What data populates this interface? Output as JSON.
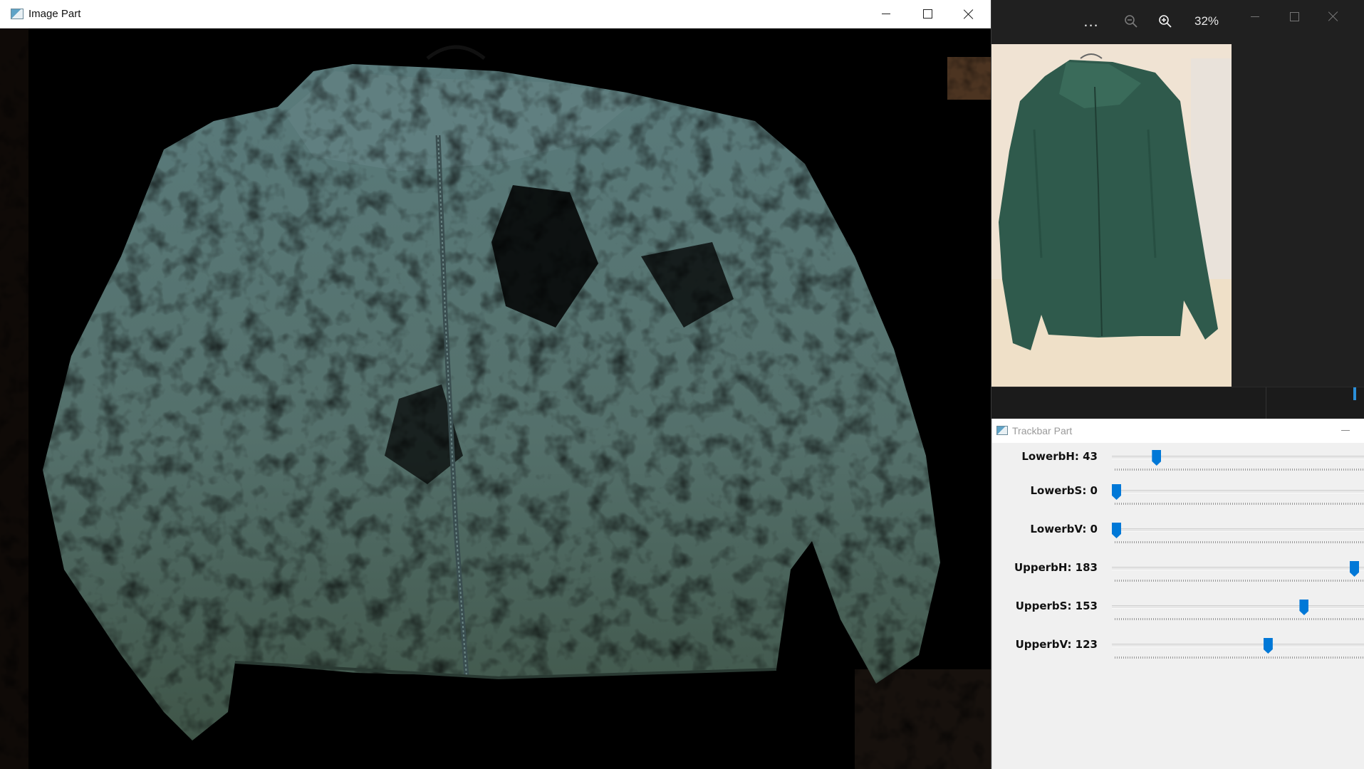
{
  "image_window": {
    "title": "Image Part",
    "controls": [
      "minimize",
      "maximize",
      "close"
    ]
  },
  "photo_viewer": {
    "more_label": "...",
    "zoom_level": "32%",
    "icons": [
      "more-icon",
      "zoom-out-icon",
      "zoom-in-icon"
    ]
  },
  "trackbar_window": {
    "title": "Trackbar Part",
    "trackbars": [
      {
        "label": "LowerbH: 43",
        "value": 43,
        "max": 255
      },
      {
        "label": "LowerbS: 0",
        "value": 0,
        "max": 255
      },
      {
        "label": "LowerbV: 0",
        "value": 0,
        "max": 255
      },
      {
        "label": "UpperbH: 183",
        "value": 183,
        "max": 183
      },
      {
        "label": "UpperbS: 153",
        "value": 153,
        "max": 194
      },
      {
        "label": "UpperbV: 123",
        "value": 123,
        "max": 193
      }
    ]
  },
  "colors": {
    "slider_thumb": "#0078d7",
    "jacket_teal": "#4f6e6e",
    "photo_background": "#f1e5d8"
  }
}
